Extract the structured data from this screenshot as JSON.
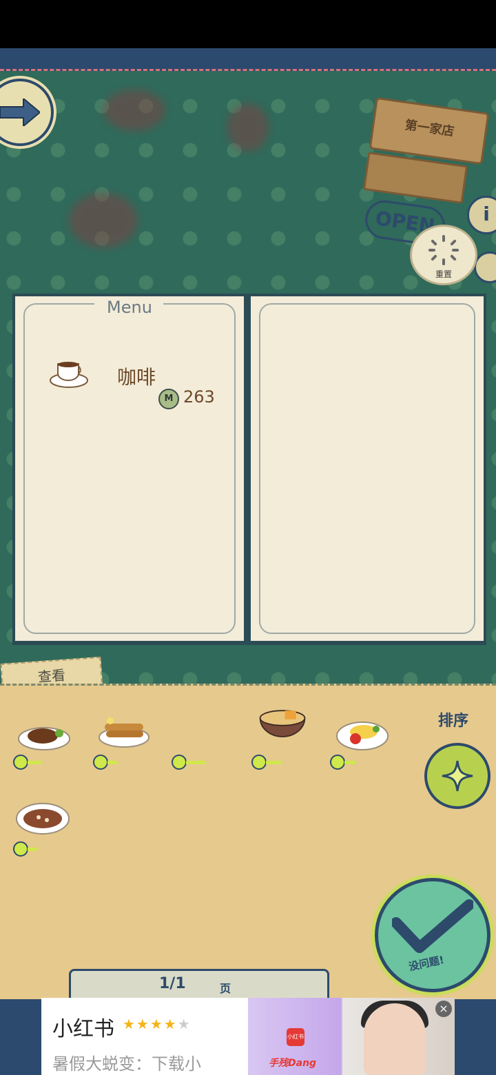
{
  "shop": {
    "sign": "第一家店",
    "open_label": "OPEN",
    "reset_label": "重置"
  },
  "menu": {
    "title": "Menu",
    "items": [
      {
        "name": "咖啡",
        "coin_symbol": "M",
        "price": "263",
        "icon": "coffee-cup-icon"
      }
    ]
  },
  "view_tab": "查看",
  "sort": {
    "label": "排序"
  },
  "confirm": {
    "label": "没问题!"
  },
  "pager": {
    "page": "1/1",
    "unit": "页"
  },
  "dishes": [
    {
      "icon": "steak-dish-icon"
    },
    {
      "icon": "skewer-dish-icon"
    },
    {
      "icon": "empty-dish-icon"
    },
    {
      "icon": "noodle-bowl-icon"
    },
    {
      "icon": "omelette-rice-icon"
    },
    {
      "icon": "curry-dish-icon"
    }
  ],
  "ad": {
    "title": "小红书",
    "rating": 4,
    "subtitle": "暑假大蜕变：下载小",
    "brand": "手残Dang",
    "logo_text": "小红书"
  },
  "colors": {
    "navy": "#2d4a6b",
    "paper": "#f3ecd8",
    "tray": "#e6c98d",
    "accent_green": "#b7d14e"
  }
}
